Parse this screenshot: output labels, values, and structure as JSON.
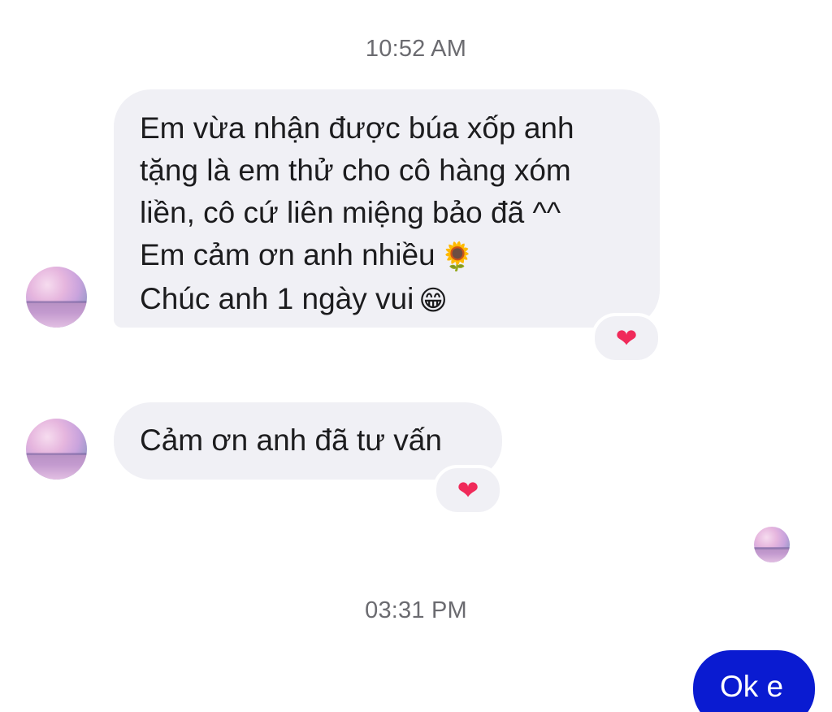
{
  "conversation": {
    "timestamps": [
      "10:52 AM",
      "03:31 PM"
    ],
    "incoming": [
      {
        "lines": [
          "Em vừa nhận được búa xốp anh",
          "tặng là em thử cho cô hàng xóm",
          "liền, cô cứ liên miệng bảo đã ^^",
          "Em cảm ơn anh nhiều",
          "Chúc anh 1 ngày vui"
        ],
        "emojis": [
          "🌻",
          "😁"
        ],
        "reaction": "❤"
      },
      {
        "text": "Cảm ơn anh đã tư vấn",
        "reaction": "❤"
      }
    ],
    "outgoing": [
      {
        "text": "Ok e"
      }
    ]
  },
  "colors": {
    "incoming_bubble": "#f0f0f5",
    "outgoing_bubble": "#0a1bd1",
    "timestamp_text": "#6b6b70",
    "reaction_heart": "#f02a5a"
  },
  "icons": {
    "reaction": "heart-icon",
    "emoji_1": "sunflower-emoji-icon",
    "emoji_2": "grinning-face-emoji-icon"
  }
}
